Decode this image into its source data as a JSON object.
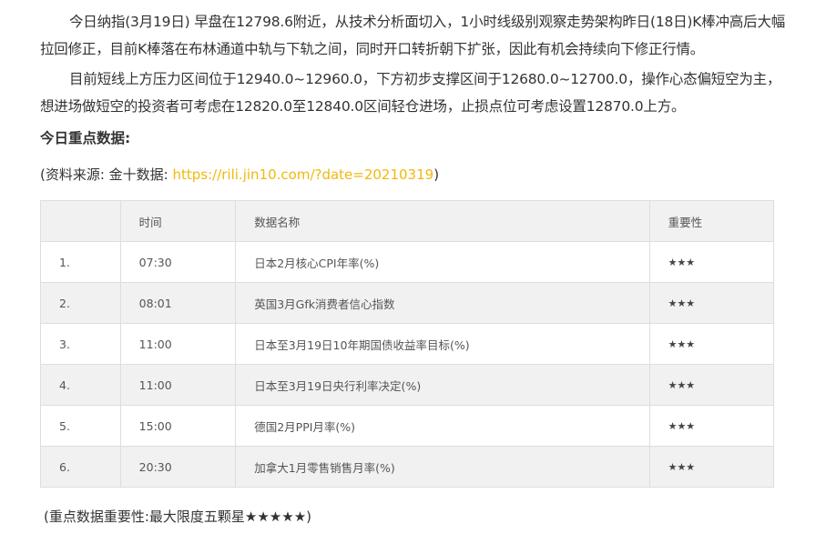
{
  "article": {
    "para1": "今日纳指(3月19日) 早盘在12798.6附近，从技术分析面切入，1小时线级别观察走势架构昨日(18日)K棒冲高后大幅拉回修正，目前K棒落在布林通道中轨与下轨之间，同时开口转折朝下扩张，因此有机会持续向下修正行情。",
    "para2": "目前短线上方压力区间位于12940.0~12960.0，下方初步支撑区间于12680.0~12700.0，操作心态偏短空为主，想进场做短空的投资者可考虑在12820.0至12840.0区间轻仓进场，止损点位可考虑设置12870.0上方。",
    "heading": "今日重点数据:",
    "source_prefix": "(资料来源: 金十数据: ",
    "source_link": "https://rili.jin10.com/?date=20210319",
    "source_suffix": ")",
    "note": "(重点数据重要性:最大限度五颗星★★★★★)"
  },
  "table": {
    "headers": [
      "",
      "时间",
      "数据名称",
      "重要性"
    ],
    "rows": [
      {
        "idx": "1.",
        "time": "07:30",
        "name": "日本2月核心CPI年率(%)",
        "stars": "★★★"
      },
      {
        "idx": "2.",
        "time": "08:01",
        "name": "英国3月Gfk消费者信心指数",
        "stars": "★★★"
      },
      {
        "idx": "3.",
        "time": "11:00",
        "name": "日本至3月19日10年期国债收益率目标(%)",
        "stars": "★★★"
      },
      {
        "idx": "4.",
        "time": "11:00",
        "name": "日本至3月19日央行利率决定(%)",
        "stars": "★★★"
      },
      {
        "idx": "5.",
        "time": "15:00",
        "name": "德国2月PPI月率(%)",
        "stars": "★★★"
      },
      {
        "idx": "6.",
        "time": "20:30",
        "name": "加拿大1月零售销售月率(%)",
        "stars": "★★★"
      }
    ]
  },
  "colors": {
    "link": "#f0b90b",
    "row_shade": "#f1f1f1",
    "border": "#dddddd"
  }
}
